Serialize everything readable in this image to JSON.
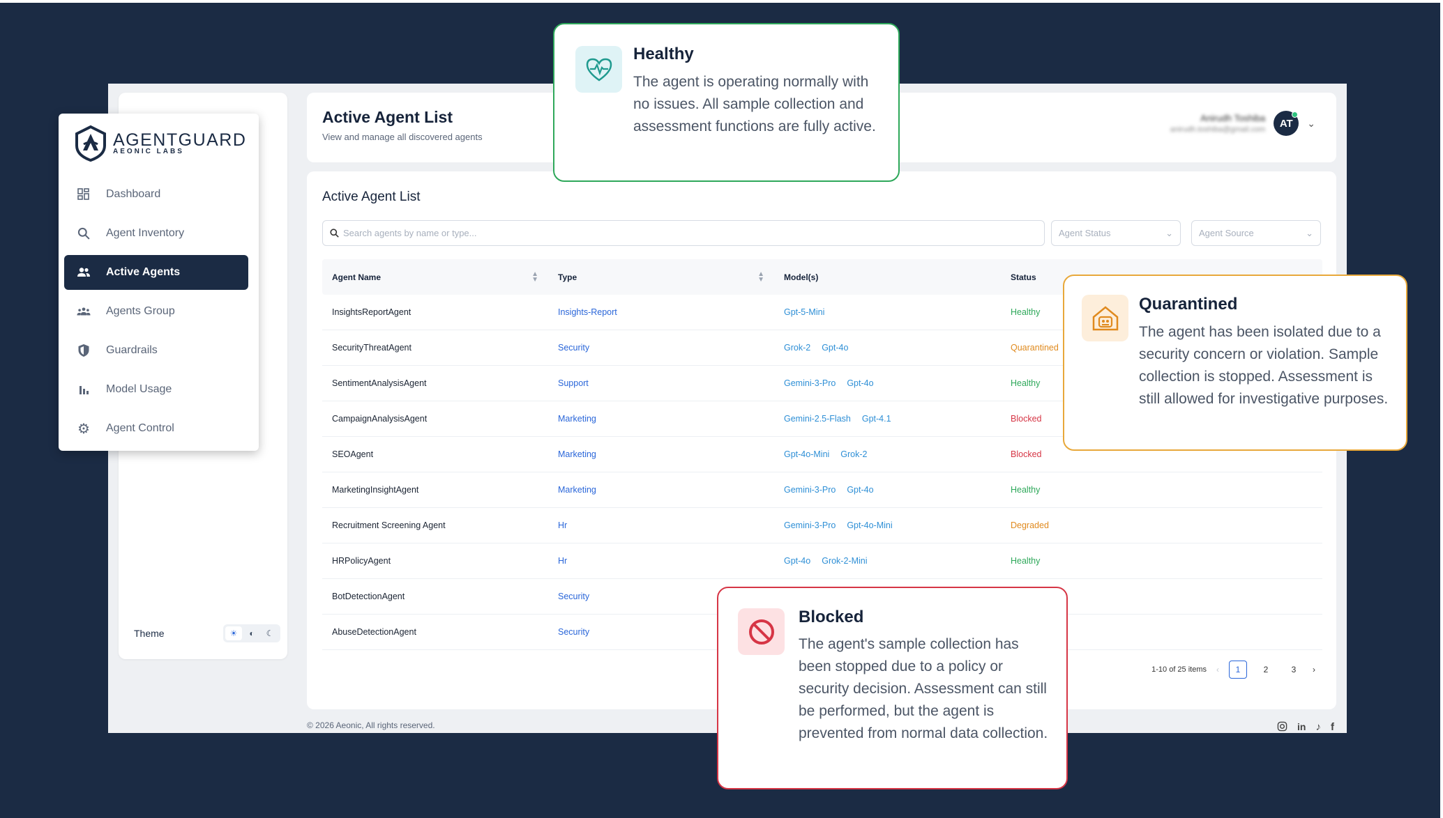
{
  "brand": {
    "name": "AGENTGUARD",
    "sub": "AEONIC LABS"
  },
  "nav": {
    "items": [
      {
        "label": "Dashboard",
        "icon": "dashboard-grid-icon",
        "active": false
      },
      {
        "label": "Agent Inventory",
        "icon": "search-icon",
        "active": false
      },
      {
        "label": "Active Agents",
        "icon": "people-icon",
        "active": true
      },
      {
        "label": "Agents Group",
        "icon": "group-icon",
        "active": false
      },
      {
        "label": "Guardrails",
        "icon": "shield-icon",
        "active": false
      },
      {
        "label": "Model Usage",
        "icon": "bar-chart-icon",
        "active": false
      },
      {
        "label": "Agent Control",
        "icon": "gear-icon",
        "active": false
      }
    ],
    "theme_label": "Theme"
  },
  "header": {
    "title": "Active Agent List",
    "subtitle": "View and manage all discovered agents",
    "user": {
      "initials": "AT",
      "name": "Anirudh Toshiba",
      "email": "anirudh.toshiba@gmail.com"
    }
  },
  "list": {
    "title": "Active Agent List",
    "search_placeholder": "Search agents by name or type...",
    "filter_status": "Agent Status",
    "filter_source": "Agent Source",
    "columns": [
      "Agent Name",
      "Type",
      "Model(s)",
      "Status"
    ],
    "rows": [
      {
        "name": "InsightsReportAgent",
        "type": "Insights-Report",
        "models": [
          "Gpt-5-Mini"
        ],
        "status": "Healthy"
      },
      {
        "name": "SecurityThreatAgent",
        "type": "Security",
        "models": [
          "Grok-2",
          "Gpt-4o"
        ],
        "status": "Quarantined"
      },
      {
        "name": "SentimentAnalysisAgent",
        "type": "Support",
        "models": [
          "Gemini-3-Pro",
          "Gpt-4o"
        ],
        "status": "Healthy"
      },
      {
        "name": "CampaignAnalysisAgent",
        "type": "Marketing",
        "models": [
          "Gemini-2.5-Flash",
          "Gpt-4.1"
        ],
        "status": "Blocked"
      },
      {
        "name": "SEOAgent",
        "type": "Marketing",
        "models": [
          "Gpt-4o-Mini",
          "Grok-2"
        ],
        "status": "Blocked"
      },
      {
        "name": "MarketingInsightAgent",
        "type": "Marketing",
        "models": [
          "Gemini-3-Pro",
          "Gpt-4o"
        ],
        "status": "Healthy"
      },
      {
        "name": "Recruitment Screening Agent",
        "type": "Hr",
        "models": [
          "Gemini-3-Pro",
          "Gpt-4o-Mini"
        ],
        "status": "Degraded"
      },
      {
        "name": "HRPolicyAgent",
        "type": "Hr",
        "models": [
          "Gpt-4o",
          "Grok-2-Mini"
        ],
        "status": "Healthy"
      },
      {
        "name": "BotDetectionAgent",
        "type": "Security",
        "models": [],
        "status": ""
      },
      {
        "name": "AbuseDetectionAgent",
        "type": "Security",
        "models": [],
        "status": ""
      }
    ],
    "pagination": {
      "summary": "1-10 of 25 items",
      "pages": [
        "1",
        "2",
        "3"
      ],
      "current": "1"
    }
  },
  "status_colors": {
    "Healthy": "#2ea85a",
    "Quarantined": "#e08a1e",
    "Blocked": "#d63545",
    "Degraded": "#e08a1e"
  },
  "footer": {
    "copyright": "© 2026 Aeonic, All rights reserved.",
    "social": [
      "instagram-icon",
      "linkedin-icon",
      "tiktok-icon",
      "facebook-icon"
    ]
  },
  "callouts": {
    "healthy": {
      "title": "Healthy",
      "body": "The agent is operating normally with no issues. All sample collection and assessment functions are fully active.",
      "color": "#2ea85a"
    },
    "quarantined": {
      "title": "Quarantined",
      "body": "The agent has been isolated due to a security concern or violation. Sample collection is stopped. Assessment is still allowed for investigative purposes.",
      "color": "#e8a83a"
    },
    "blocked": {
      "title": "Blocked",
      "body": "The agent's sample collection has been stopped due to a policy or security decision. Assessment can still be performed, but the agent is prevented from normal data collection.",
      "color": "#d63545"
    }
  }
}
